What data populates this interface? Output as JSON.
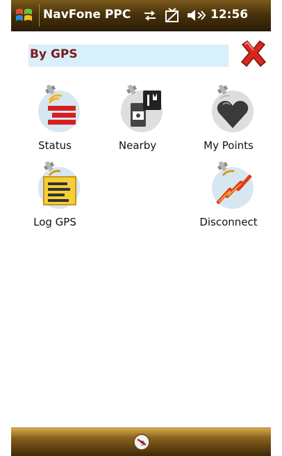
{
  "titlebar": {
    "app_title": "NavFone PPC",
    "clock": "12:56",
    "icons": [
      "start-menu-icon",
      "connectivity-icon",
      "signal-icon",
      "volume-icon"
    ]
  },
  "header": {
    "title": "By GPS",
    "close_icon": "close-x-icon"
  },
  "tiles": [
    {
      "label": "Status",
      "icon": "gps-status-icon"
    },
    {
      "label": "Nearby",
      "icon": "nearby-icon"
    },
    {
      "label": "My Points",
      "icon": "heart-points-icon"
    },
    {
      "label": "Log GPS",
      "icon": "log-gps-icon"
    },
    {
      "label": "Disconnect",
      "icon": "disconnect-icon"
    }
  ],
  "bottombar": {
    "icon": "input-panel-icon"
  },
  "colors": {
    "title_gradient_top": "#7a5a1b",
    "title_gradient_bottom": "#2d1e06",
    "header_bg": "#d8f0fb",
    "header_text": "#7a1a1a",
    "close_red": "#d8281e"
  }
}
